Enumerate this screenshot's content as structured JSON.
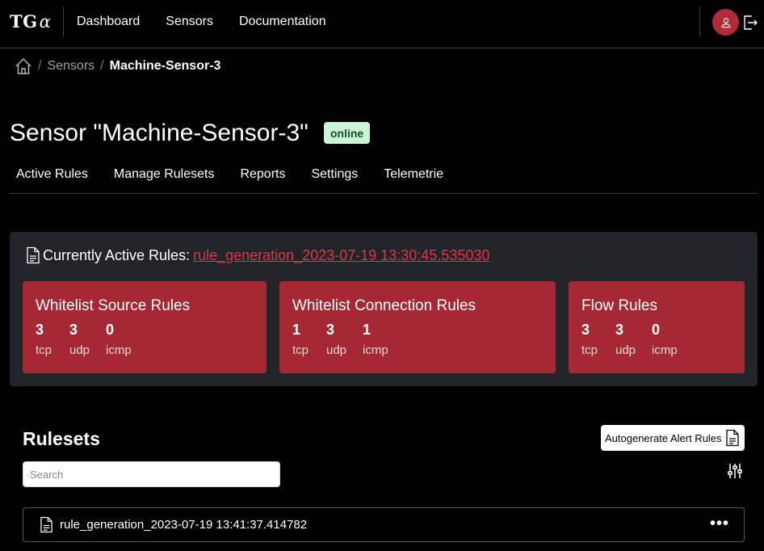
{
  "nav": {
    "brand": "TG",
    "brand_suffix": "α",
    "links": [
      "Dashboard",
      "Sensors",
      "Documentation"
    ]
  },
  "breadcrumb": {
    "sensors": "Sensors",
    "current": "Machine-Sensor-3"
  },
  "page": {
    "title": "Sensor \"Machine-Sensor-3\"",
    "status": "online",
    "status_color": "#c9f5d5"
  },
  "tabs": [
    "Active Rules",
    "Manage Rulesets",
    "Reports",
    "Settings",
    "Telemetrie"
  ],
  "active_rules": {
    "label": "Currently Active Rules:",
    "ruleset": "rule_generation_2023-07-19 13:30:45.535030",
    "cards": [
      {
        "title": "Whitelist Source Rules",
        "tcp": "3",
        "udp": "3",
        "icmp": "0"
      },
      {
        "title": "Whitelist Connection Rules",
        "tcp": "1",
        "udp": "3",
        "icmp": "1"
      },
      {
        "title": "Flow Rules",
        "tcp": "3",
        "udp": "3",
        "icmp": "0"
      }
    ],
    "labels": {
      "tcp": "tcp",
      "udp": "udp",
      "icmp": "icmp"
    },
    "card_color": "#a52834"
  },
  "rulesets": {
    "title": "Rulesets",
    "autogen_label": "Autogenerate Alert Rules",
    "search_placeholder": "Search",
    "items": [
      {
        "name": "rule_generation_2023-07-19 13:41:37.414782"
      }
    ]
  },
  "colors": {
    "accent": "#dc3545",
    "avatar": "#b02a37"
  }
}
